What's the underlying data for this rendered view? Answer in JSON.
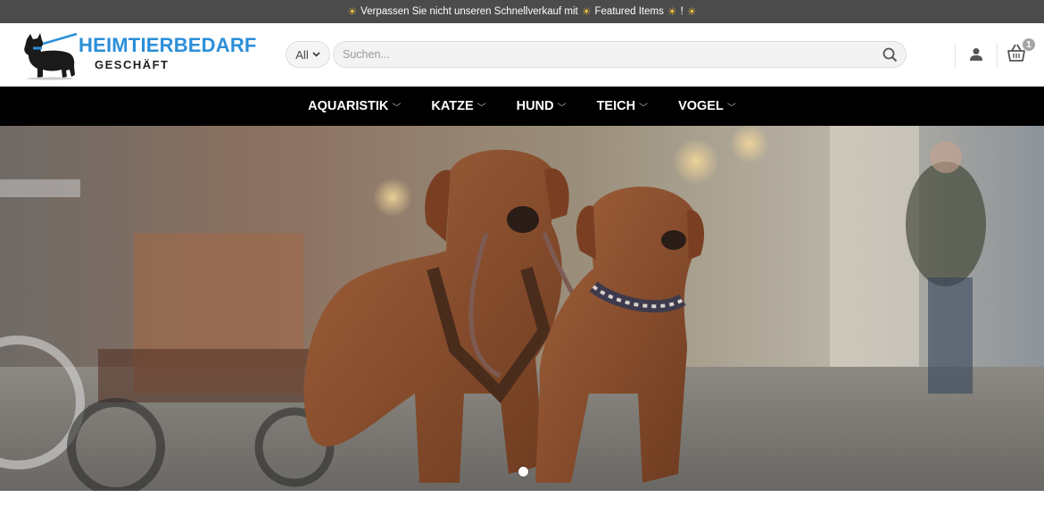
{
  "topbar": {
    "text_before": "Verpassen Sie nicht unseren Schnellverkauf mit",
    "text_featured": "Featured Items",
    "text_end": "!",
    "icon": "sun-emoji"
  },
  "header": {
    "logo_title": "HEIMTIERBEDARF",
    "logo_subtitle": "GESCHÄFT",
    "category_select": "All",
    "search_placeholder": "Suchen...",
    "cart_count": "1"
  },
  "nav": {
    "items": [
      {
        "label": "AQUARISTIK"
      },
      {
        "label": "KATZE"
      },
      {
        "label": "HUND"
      },
      {
        "label": "TEICH"
      },
      {
        "label": "VOGEL"
      }
    ]
  },
  "hero": {
    "image_subject": "two-rhodesian-ridgebacks-on-street",
    "active_slide": "1"
  },
  "colors": {
    "brand_blue": "#2b8fd8",
    "topbar_bg": "#4b4b4b",
    "nav_bg": "#000000"
  }
}
